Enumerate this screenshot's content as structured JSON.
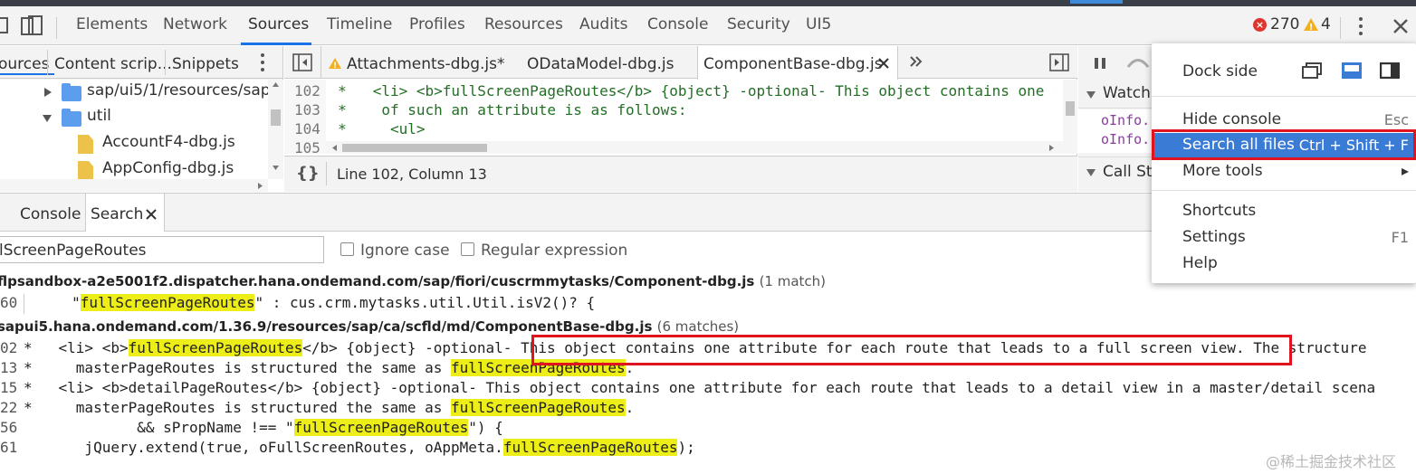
{
  "toolbar": {
    "tabs": [
      "Elements",
      "Network",
      "Sources",
      "Timeline",
      "Profiles",
      "Resources",
      "Audits",
      "Console",
      "Security",
      "UI5"
    ],
    "error_count": "270",
    "warning_count": "4"
  },
  "navigator": {
    "tabs": [
      "ources",
      "Content scrip...",
      "Snippets"
    ],
    "tree": [
      {
        "type": "folder",
        "label": "sap/ui5/1/resources/sap/"
      },
      {
        "type": "folder",
        "label": "util"
      },
      {
        "type": "file",
        "label": "AccountF4-dbg.js"
      },
      {
        "type": "file",
        "label": "AppConfig-dbg.js"
      }
    ]
  },
  "editor": {
    "tabs": [
      {
        "label": "Attachments-dbg.js*",
        "warning": true
      },
      {
        "label": "ODataModel-dbg.js"
      },
      {
        "label": "ComponentBase-dbg.js"
      }
    ],
    "lines": [
      {
        "no": "102",
        "text": "*   <li> <b>fullScreenPageRoutes</b> {object} -optional- This object contains one"
      },
      {
        "no": "103",
        "text": "*    of such an attribute is as follows:"
      },
      {
        "no": "104",
        "text": "*     <ul>"
      },
      {
        "no": "105",
        "text": ""
      }
    ],
    "status": "Line 102, Column 13",
    "format_icon": "{}"
  },
  "debugger": {
    "watch_label": "Watch",
    "watch_items": [
      "oInfo.",
      "oInfo."
    ],
    "callstack_label": "Call Sta"
  },
  "drawer": {
    "tabs": [
      "Console",
      "Search"
    ]
  },
  "search": {
    "query": "lScreenPageRoutes",
    "ignore_case_label": "Ignore case",
    "regex_label": "Regular expression",
    "results": [
      {
        "file": "flpsandbox-a2e5001f2.dispatcher.hana.ondemand.com/sap/fiori/cuscrmmytasks/Component-dbg.js",
        "count": "(1 match)",
        "lines": [
          {
            "no": "60",
            "pre": "     \"",
            "match": "fullScreenPageRoutes",
            "post": "\" : cus.crm.mytasks.util.Util.isV2()? {"
          }
        ]
      },
      {
        "file": "sapui5.hana.ondemand.com/1.36.9/resources/sap/ca/scfld/md/ComponentBase-dbg.js",
        "count": "(6 matches)",
        "lines": [
          {
            "no": "02",
            "pre": "*   <li> <b>",
            "match": "fullScreenPageRoutes",
            "post": "</b> {object} -optional- This object contains one attribute for each route that leads to a full screen view. The structure"
          },
          {
            "no": "13",
            "pre": "*     masterPageRoutes is structured the same as ",
            "match": "fullScreenPageRoutes",
            "post": "."
          },
          {
            "no": "15",
            "pre": "*   <li> <b>detailPageRoutes</b> {object} -optional- This object contains one attribute for each route that leads to a detail view in a master/detail scena",
            "match": "",
            "post": ""
          },
          {
            "no": "22",
            "pre": "*     masterPageRoutes is structured the same as ",
            "match": "fullScreenPageRoutes",
            "post": "."
          },
          {
            "no": "56",
            "pre": "             && sPropName !== \"",
            "match": "fullScreenPageRoutes",
            "post": "\") {"
          },
          {
            "no": "61",
            "pre": "       jQuery.extend(true, oFullScreenRoutes, oAppMeta.",
            "match": "fullScreenPageRoutes",
            "post": ");"
          }
        ]
      }
    ]
  },
  "menu": {
    "dock_side_label": "Dock side",
    "items": [
      {
        "label": "Hide console",
        "shortcut": "Esc"
      },
      {
        "label": "Search all files",
        "shortcut": "Ctrl + Shift + F",
        "highlighted": true
      },
      {
        "label": "More tools",
        "shortcut": "▸"
      },
      {
        "label": "Shortcuts",
        "shortcut": ""
      },
      {
        "label": "Settings",
        "shortcut": "F1"
      },
      {
        "label": "Help",
        "shortcut": ""
      }
    ],
    "accent_color": "#3a7bd5"
  },
  "watermark": "@稀土掘金技术社区"
}
